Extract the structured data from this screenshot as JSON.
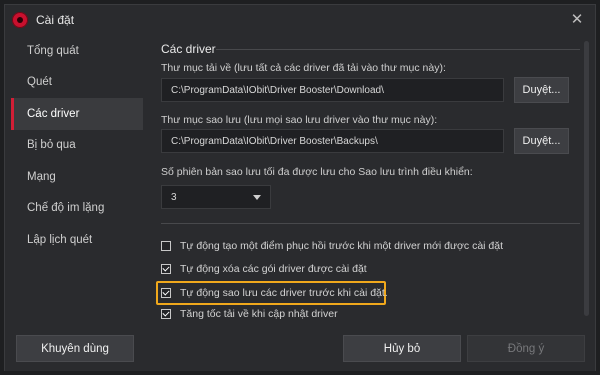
{
  "window": {
    "title": "Cài đặt",
    "close_glyph": "✕"
  },
  "sidebar": {
    "items": [
      {
        "label": "Tổng quát"
      },
      {
        "label": "Quét"
      },
      {
        "label": "Các driver"
      },
      {
        "label": "Bị bỏ qua"
      },
      {
        "label": "Mạng"
      },
      {
        "label": "Chế độ im lặng"
      },
      {
        "label": "Lập lịch quét"
      }
    ],
    "active_index": 2
  },
  "main": {
    "section_title": "Các driver",
    "download_dir": {
      "label": "Thư mục tải về (lưu tất cả các driver đã tải vào thư mục này):",
      "value": "C:\\ProgramData\\IObit\\Driver Booster\\Download\\",
      "browse_label": "Duyệt..."
    },
    "backup_dir": {
      "label": "Thư mục sao lưu (lưu mọi sao lưu driver vào thư mục này):",
      "value": "C:\\ProgramData\\IObit\\Driver Booster\\Backups\\",
      "browse_label": "Duyệt..."
    },
    "max_backups": {
      "label": "Số phiên bản sao lưu tối đa được lưu cho Sao lưu trình điều khiển:",
      "selected": "3"
    },
    "options": [
      {
        "label": "Tự động tạo một điểm phục hồi trước khi một driver mới được cài đặt",
        "checked": false
      },
      {
        "label": "Tự động xóa các gói driver được cài đặt",
        "checked": true
      },
      {
        "label": "Tự động sao lưu các driver trước khi cài đặt.",
        "checked": true,
        "highlighted": true
      },
      {
        "label": "Tăng tốc tải về khi cập nhật driver",
        "checked": true
      }
    ],
    "highlight_color": "#f0a81c"
  },
  "footer": {
    "recommend_label": "Khuyên dùng",
    "cancel_label": "Hủy bỏ",
    "ok_label": "Đồng ý"
  },
  "colors": {
    "accent": "#d21f36",
    "background": "#2a2b2e",
    "input_bg": "#1f2023"
  }
}
